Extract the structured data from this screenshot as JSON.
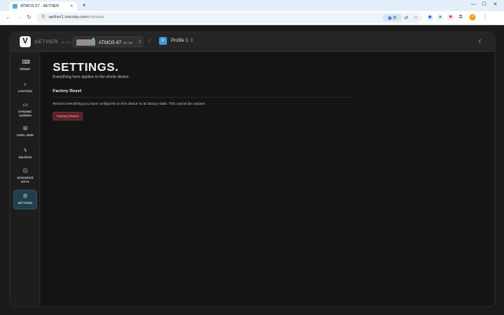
{
  "browser": {
    "tab_title": "ATMOS 67 · AETHER",
    "new_tab": "+",
    "url_host": "aether1.voicsky.com",
    "url_path": "/console",
    "translate_label": "译",
    "icons": {
      "back": "back-arrow-icon",
      "forward": "forward-arrow-icon",
      "reload": "reload-icon",
      "star": "star-icon",
      "menu": "kebab-menu-icon"
    }
  },
  "app": {
    "logo": "V",
    "brand": "AETHER",
    "version": "v1.2.6",
    "device": {
      "name": "ATMOS 67",
      "tag": "8k HE",
      "status_color": "#4ade80"
    },
    "separator": "/",
    "profile": {
      "badge": "P",
      "name": "Profile 1"
    }
  },
  "sidebar": {
    "items": [
      {
        "label": "REMAP",
        "icon": "keyboard-icon",
        "active": false
      },
      {
        "label": "LIGHTING",
        "icon": "lightbulb-icon",
        "active": false
      },
      {
        "label": "DYNAMIC SCREEN",
        "icon": "monitor-icon",
        "active": false
      },
      {
        "label": "PIXEL GRID",
        "icon": "grid-icon",
        "active": false
      },
      {
        "label": "MACROS",
        "icon": "bolt-icon",
        "active": false
      },
      {
        "label": "ADVANCED KEYS",
        "icon": "advanced-key-icon",
        "active": false
      },
      {
        "label": "SETTINGS",
        "icon": "gear-icon",
        "active": true
      }
    ]
  },
  "main": {
    "title": "SETTINGS.",
    "subtitle": "Everything here applies to the whole device.",
    "section": {
      "title": "Factory Reset",
      "description": "Returns everything you have configured on this device to its factory state. This cannot be undone.",
      "button_label": "Factory Reset"
    }
  },
  "colors": {
    "accent": "#1f3f4a",
    "danger": "#5a1f24",
    "profile_badge": "#3b9ad9"
  }
}
